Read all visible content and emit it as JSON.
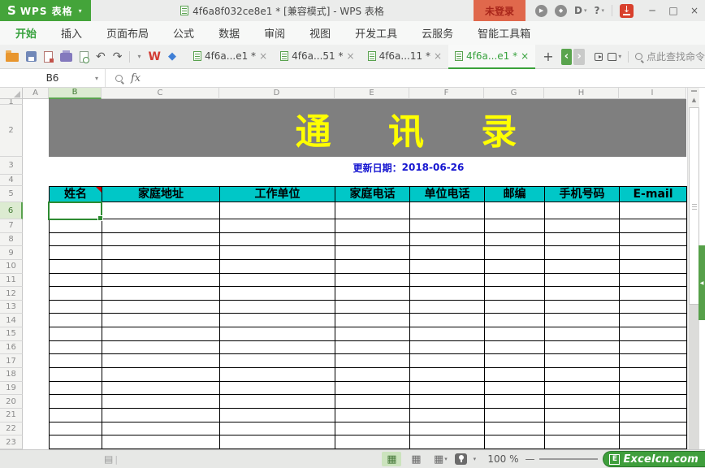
{
  "window": {
    "logo_text": "WPS 表格",
    "doc_title": "4f6a8f032ce8e1 * [兼容模式] - WPS 表格",
    "login_label": "未登录"
  },
  "icons": {
    "logo_mark": "S",
    "dropdown": "▾",
    "play": "▶",
    "diamond": "◆",
    "d_letter": "D",
    "question": "?",
    "down_arrow": "↓",
    "minimize": "─",
    "maximize": "□",
    "close": "×",
    "close_small": "×",
    "undo": "↶",
    "redo": "↷",
    "w_mark": "W",
    "cube": "◆",
    "plus": "+",
    "chev_left": "‹",
    "chev_right": "›",
    "scroll_up": "▲",
    "side_left": "◀",
    "grid_view": "▦",
    "sheet_nav": "▤",
    "cursor_bar": "|",
    "zoom_minus": "—"
  },
  "menubar": {
    "items": [
      {
        "label": "开始",
        "active": true
      },
      {
        "label": "插入",
        "active": false
      },
      {
        "label": "页面布局",
        "active": false
      },
      {
        "label": "公式",
        "active": false
      },
      {
        "label": "数据",
        "active": false
      },
      {
        "label": "审阅",
        "active": false
      },
      {
        "label": "视图",
        "active": false
      },
      {
        "label": "开发工具",
        "active": false
      },
      {
        "label": "云服务",
        "active": false
      },
      {
        "label": "智能工具箱",
        "active": false
      }
    ]
  },
  "toolbar": {
    "tabs": [
      {
        "label": "4f6a...e1 *",
        "active": false
      },
      {
        "label": "4f6a...51 *",
        "active": false
      },
      {
        "label": "4f6a...11 *",
        "active": false
      },
      {
        "label": "4f6a...e1 *",
        "active": true
      }
    ],
    "search_hint": "点此查找命令"
  },
  "formula_bar": {
    "cell_ref": "B6",
    "fx_label": "fx",
    "formula_value": ""
  },
  "sheet": {
    "columns": [
      "A",
      "B",
      "C",
      "D",
      "E",
      "F",
      "G",
      "H",
      "I"
    ],
    "selected_column": "B",
    "rows": [
      1,
      2,
      3,
      4,
      5,
      6,
      7,
      8,
      9,
      10,
      11,
      12,
      13,
      14,
      15,
      16,
      17,
      18,
      19,
      20,
      21,
      22,
      23
    ],
    "selected_row": 6,
    "selected_cell": "B6",
    "banner_title": "通 讯 录",
    "update_label": "更新日期：",
    "update_date": "2018-06-26",
    "table_headers": [
      "姓名",
      "家庭地址",
      "工作单位",
      "家庭电话",
      "单位电话",
      "邮编",
      "手机号码",
      "E-mail"
    ],
    "colors": {
      "banner_bg": "#7f7f7f",
      "banner_text": "#ffff00",
      "header_bg": "#00c7c7",
      "date_text": "#1515d0",
      "selection": "#2e8b32"
    }
  },
  "status_bar": {
    "zoom_level": "100 %",
    "brand_initial": "E",
    "brand_name": "Excelcn.com"
  }
}
